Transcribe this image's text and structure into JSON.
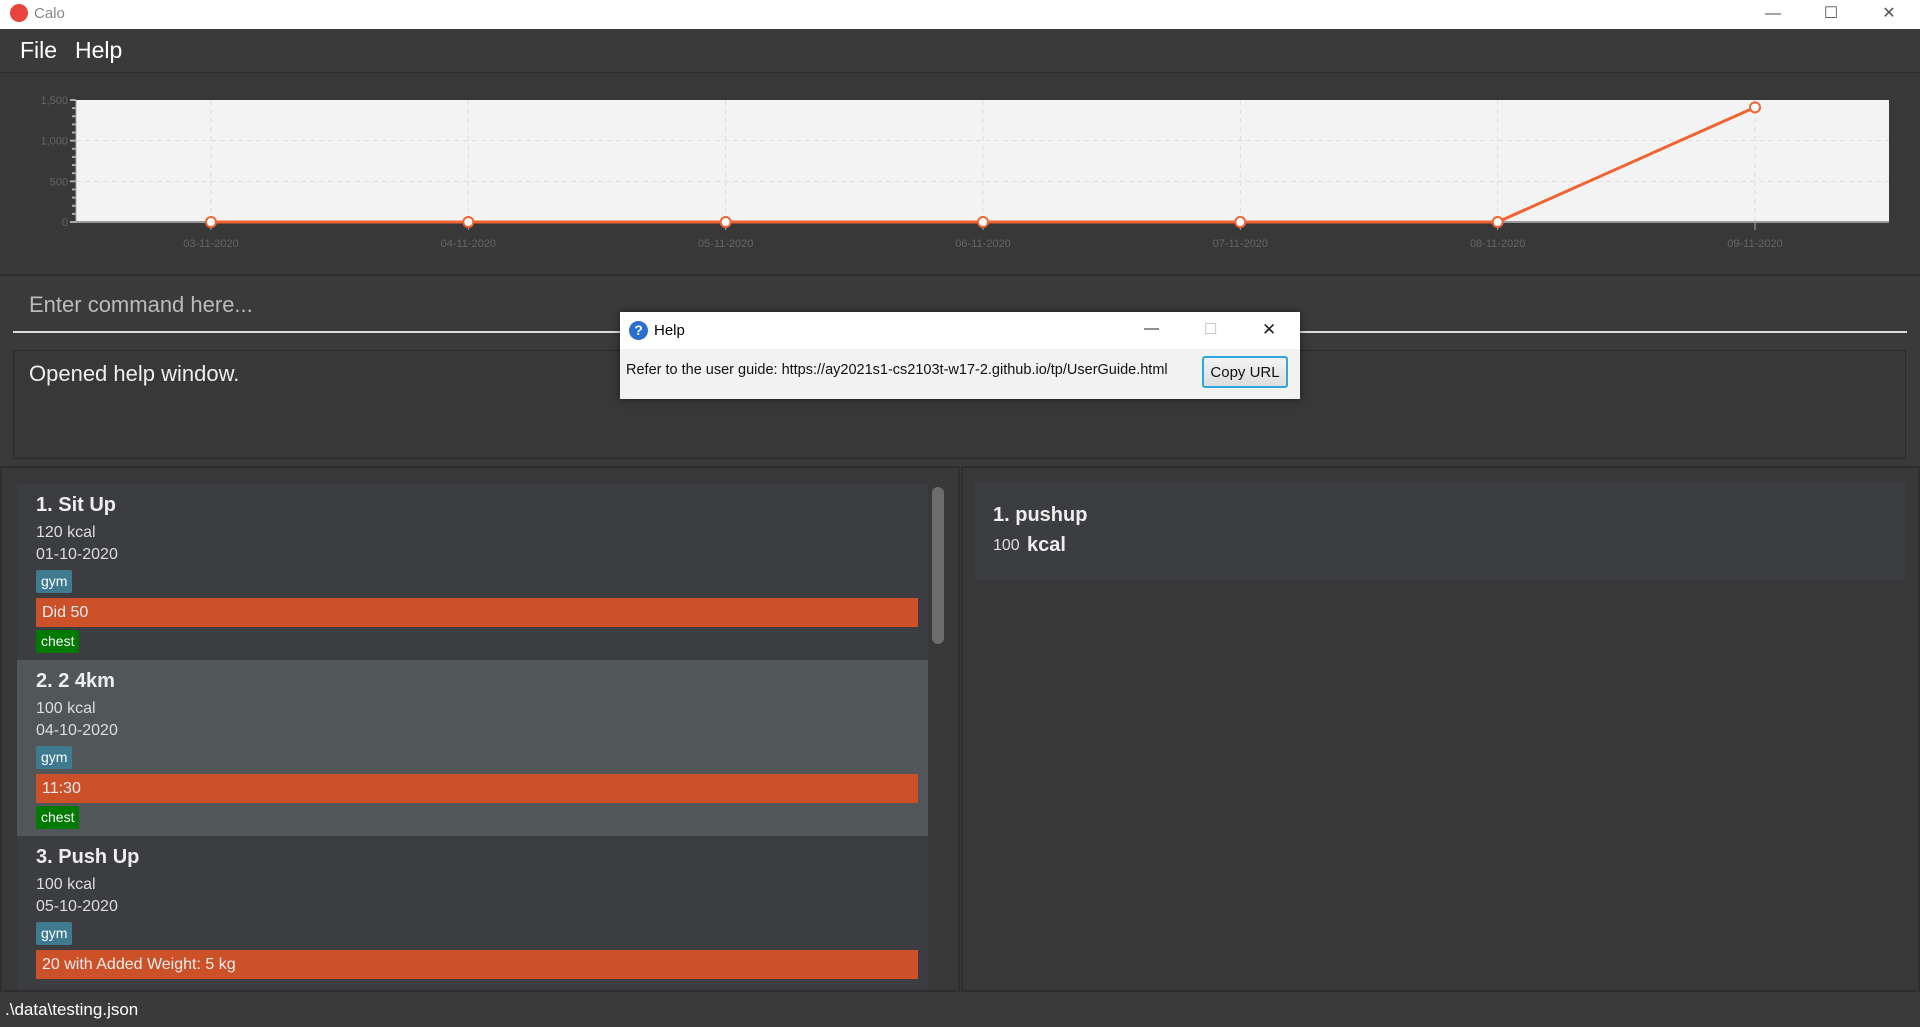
{
  "window": {
    "title": "Calo",
    "min": "—",
    "max": "☐",
    "close": "✕"
  },
  "menu": {
    "file": "File",
    "help": "Help"
  },
  "chart_data": {
    "type": "line",
    "categories": [
      "03-11-2020",
      "04-11-2020",
      "05-11-2020",
      "06-11-2020",
      "07-11-2020",
      "08-11-2020",
      "09-11-2020"
    ],
    "values": [
      0,
      0,
      0,
      0,
      0,
      0,
      1410
    ],
    "yticks": [
      "0",
      "500",
      "1,000",
      "1,500"
    ],
    "ylim": [
      0,
      1500
    ],
    "grid": true,
    "color": "#f06432"
  },
  "command": {
    "placeholder": "Enter command here..."
  },
  "result": {
    "text": "Opened help window."
  },
  "exercises": [
    {
      "title": "1.  Sit Up",
      "kcal": "120  kcal",
      "date": "01-10-2020",
      "tag1": "gym",
      "desc": "Did 50",
      "tag2": "chest"
    },
    {
      "title": "2.  2 4km",
      "kcal": "100  kcal",
      "date": "04-10-2020",
      "tag1": "gym",
      "desc": "11:30",
      "tag2": "chest"
    },
    {
      "title": "3.  Push Up",
      "kcal": "100  kcal",
      "date": "05-10-2020",
      "tag1": "gym",
      "desc": "20 with Added Weight: 5 kg"
    }
  ],
  "templates": [
    {
      "title": "1.  pushup",
      "kcal_value": "100",
      "kcal_unit": "kcal"
    }
  ],
  "status": {
    "path": ".\\data\\testing.json"
  },
  "help_dialog": {
    "title": "Help",
    "message": "Refer to the user guide: https://ay2021s1-cs2103t-w17-2.github.io/tp/UserGuide.html",
    "copy_label": "Copy URL",
    "min": "—",
    "max": "☐",
    "close": "✕"
  }
}
